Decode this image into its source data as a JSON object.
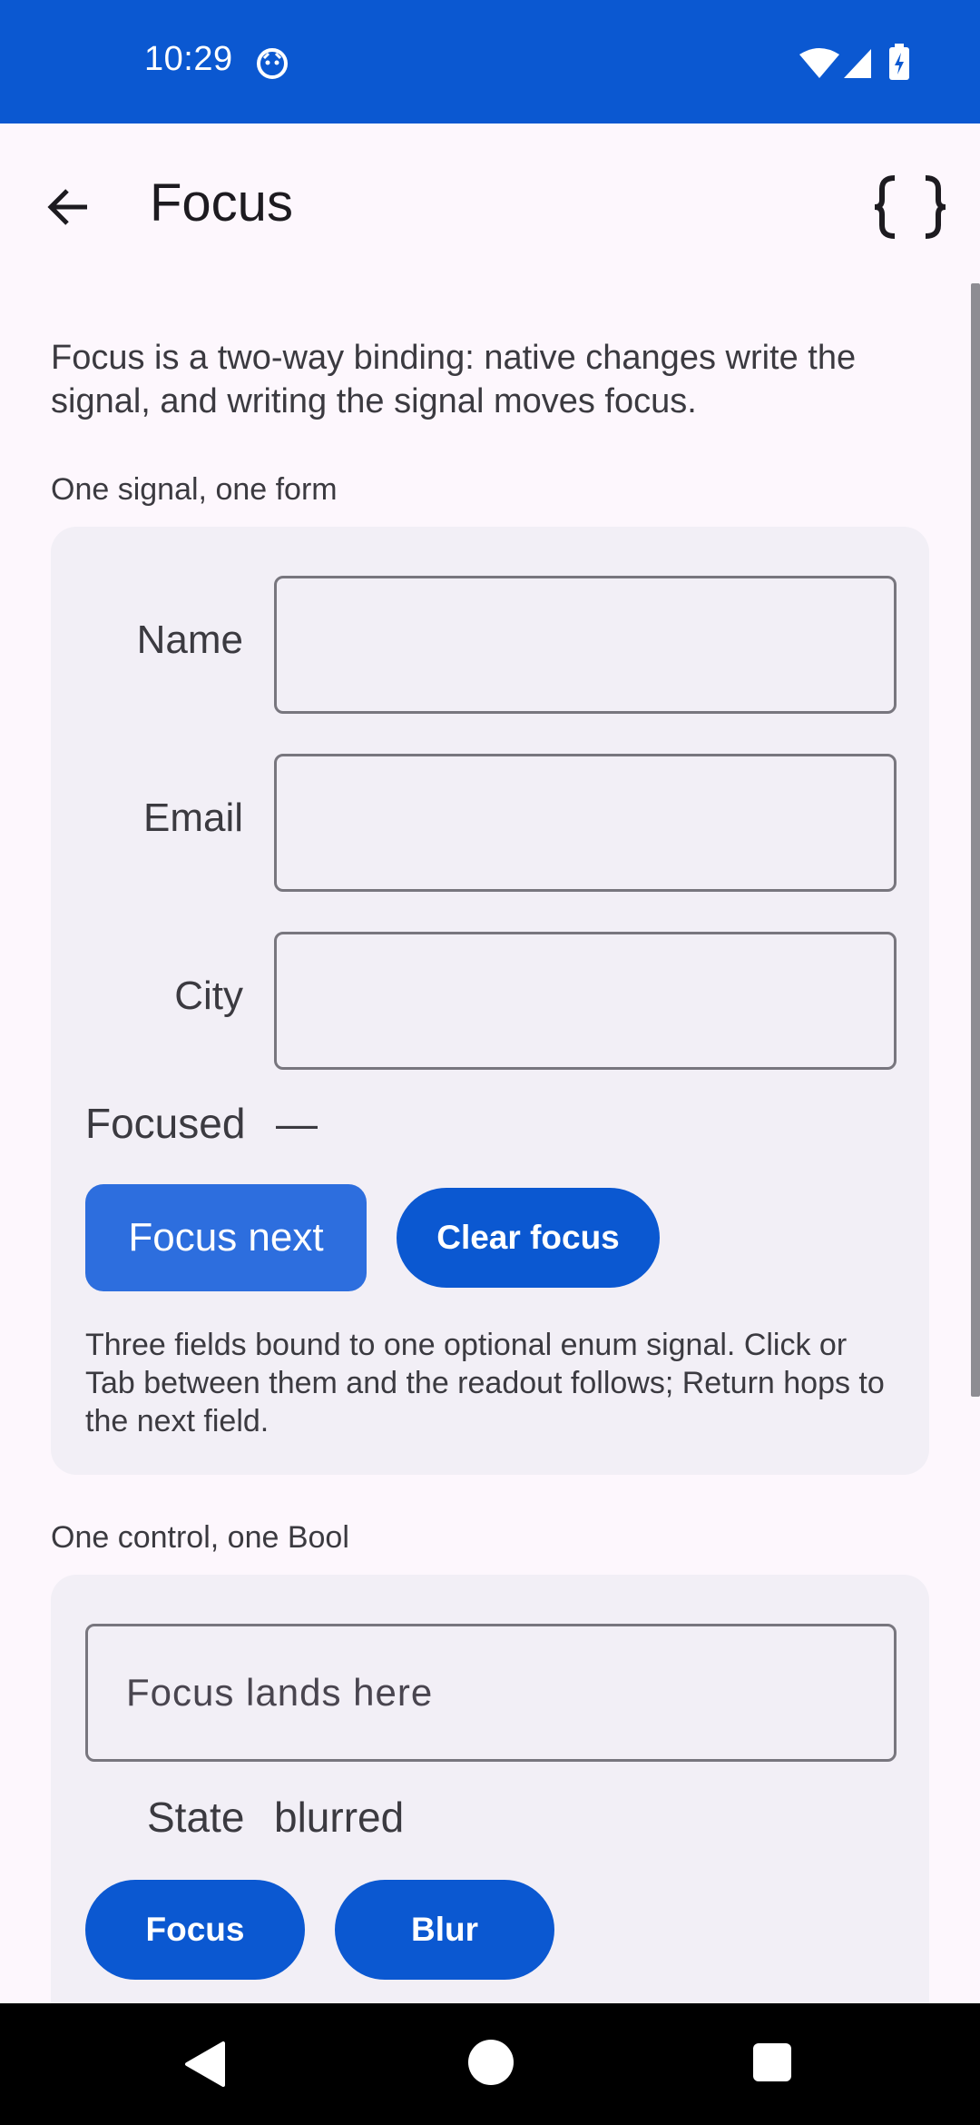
{
  "status_bar": {
    "time": "10:29",
    "icons": [
      "notification-icon",
      "wifi-icon",
      "signal-icon",
      "battery-charging-icon"
    ]
  },
  "top_bar": {
    "title": "Focus",
    "back_icon": "arrow-back-icon",
    "code_icon": "code-braces-icon"
  },
  "intro": "Focus is a two-way binding: native changes write the signal, and writing the signal moves focus.",
  "section1": {
    "label": "One signal, one form",
    "fields": [
      {
        "label": "Name",
        "value": ""
      },
      {
        "label": "Email",
        "value": ""
      },
      {
        "label": "City",
        "value": ""
      }
    ],
    "focused_label": "Focused",
    "focused_value": "—",
    "focus_next_label": "Focus next",
    "clear_focus_label": "Clear focus",
    "note": "Three fields bound to one optional enum signal. Click or Tab between them and the readout follows; Return hops to the next field."
  },
  "section2": {
    "label": "One control, one Bool",
    "field_placeholder": "Focus lands here",
    "state_label": "State",
    "state_value": "blurred",
    "focus_label": "Focus",
    "blur_label": "Blur"
  },
  "colors": {
    "primary": "#0B58D1",
    "focused_button": "#2D6EDE",
    "card_background": "#F2EFF6",
    "page_background": "#FDF7FD"
  }
}
